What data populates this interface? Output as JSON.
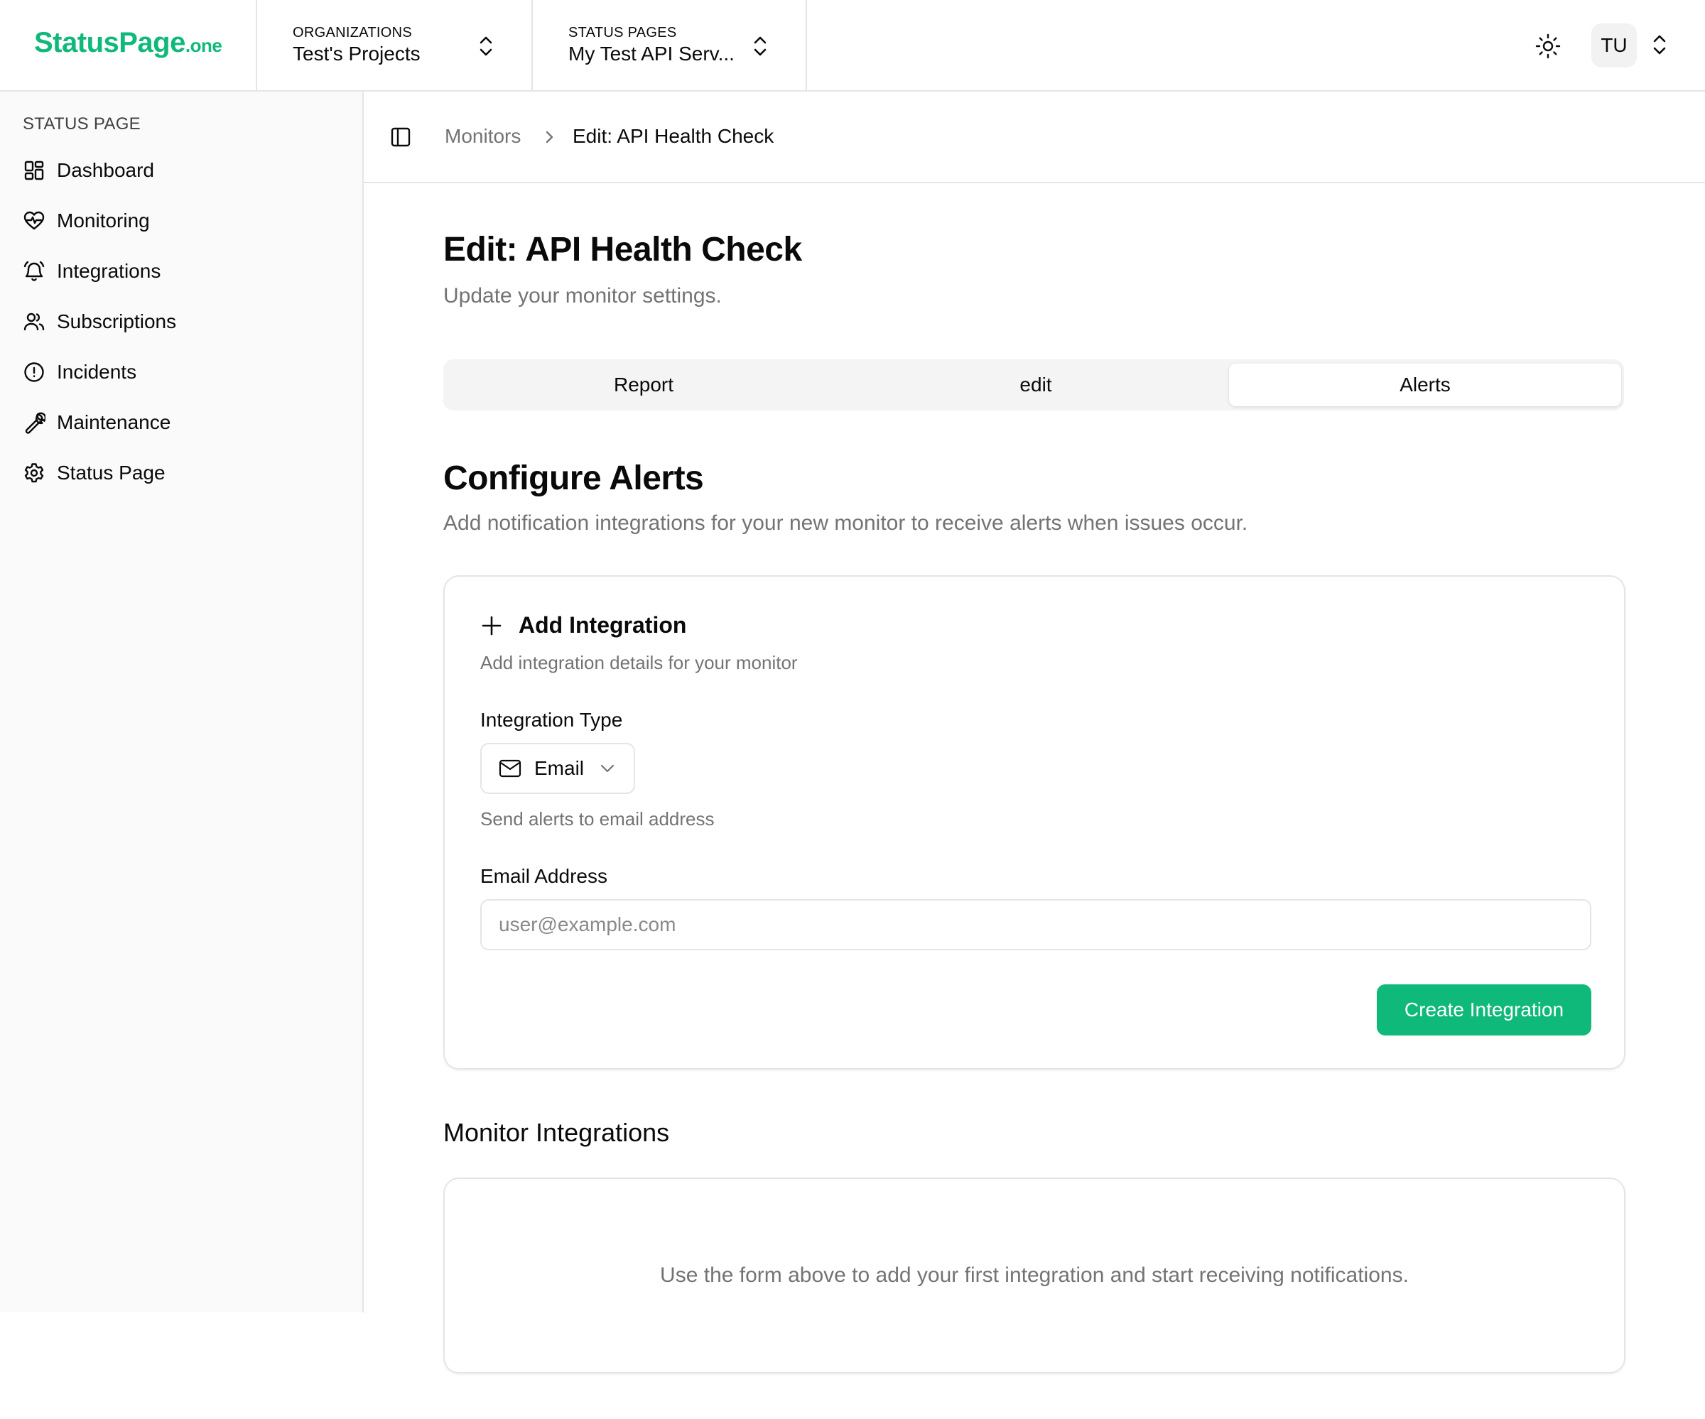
{
  "brand": {
    "name": "StatusPage",
    "suffix": ".one",
    "color": "#10b97a"
  },
  "header": {
    "organizations": {
      "caption": "ORGANIZATIONS",
      "value": "Test's Projects"
    },
    "status_pages": {
      "caption": "STATUS PAGES",
      "value": "My Test API Serv..."
    },
    "user_initials": "TU"
  },
  "sidebar": {
    "section": "STATUS PAGE",
    "items": [
      {
        "label": "Dashboard",
        "icon": "dashboard-icon"
      },
      {
        "label": "Monitoring",
        "icon": "heart-pulse-icon"
      },
      {
        "label": "Integrations",
        "icon": "bell-ring-icon"
      },
      {
        "label": "Subscriptions",
        "icon": "users-icon"
      },
      {
        "label": "Incidents",
        "icon": "alert-circle-icon"
      },
      {
        "label": "Maintenance",
        "icon": "wrench-icon"
      },
      {
        "label": "Status Page",
        "icon": "settings-icon"
      }
    ]
  },
  "breadcrumb": {
    "parent": "Monitors",
    "current": "Edit: API Health Check"
  },
  "page": {
    "title": "Edit: API Health Check",
    "subtitle": "Update your monitor settings."
  },
  "tabs": [
    {
      "label": "Report",
      "active": false
    },
    {
      "label": "edit",
      "active": false
    },
    {
      "label": "Alerts",
      "active": true
    }
  ],
  "alerts": {
    "title": "Configure Alerts",
    "subtitle": "Add notification integrations for your new monitor to receive alerts when issues occur.",
    "add": {
      "title": "Add Integration",
      "description": "Add integration details for your monitor",
      "type_label": "Integration Type",
      "type_value": "Email",
      "type_help": "Send alerts to email address",
      "email_label": "Email Address",
      "email_value": "",
      "email_placeholder": "user@example.com",
      "create_label": "Create Integration"
    },
    "list": {
      "title": "Monitor Integrations",
      "empty": "Use the form above to add your first integration and start receiving notifications."
    }
  }
}
